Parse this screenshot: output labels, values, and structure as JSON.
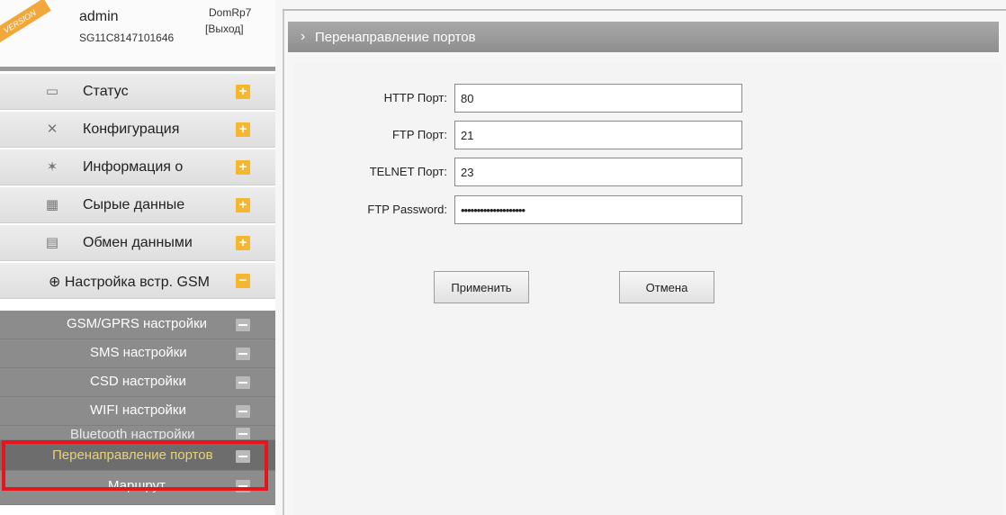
{
  "user": {
    "ribbon": "VERSION",
    "name": "admin",
    "serial": "SG11C8147101646",
    "device": "DomRp7",
    "logout": "[Выход]"
  },
  "menu": [
    {
      "label": "Статус",
      "icon": "monitor-icon"
    },
    {
      "label": "Конфигурация",
      "icon": "tools-icon"
    },
    {
      "label": "Информация о",
      "icon": "satellite-icon"
    },
    {
      "label": "Сырые данные",
      "icon": "calendar-icon"
    },
    {
      "label": "Обмен данными",
      "icon": "computer-icon"
    },
    {
      "label": "Настройка встр. GSM",
      "icon": "globe-icon"
    }
  ],
  "submenu": [
    {
      "label": "GSM/GPRS настройки"
    },
    {
      "label": "SMS настройки"
    },
    {
      "label": "CSD настройки"
    },
    {
      "label": "WIFI настройки"
    },
    {
      "label": "Bluetooth настройки"
    },
    {
      "label": "Перенаправление портов"
    },
    {
      "label": "Маршрут"
    }
  ],
  "page": {
    "title": "Перенаправление портов"
  },
  "form": {
    "http_label": "HTTP Порт:",
    "http_value": "80",
    "ftp_label": "FTP Порт:",
    "ftp_value": "21",
    "telnet_label": "TELNET Порт:",
    "telnet_value": "23",
    "password_label": "FTP Password:",
    "password_value": "••••••••••••••••••••"
  },
  "buttons": {
    "apply": "Применить",
    "cancel": "Отмена"
  },
  "colors": {
    "accent": "#f5b630",
    "highlight": "#e8141b",
    "submenu_bg": "#8c8c8c"
  }
}
